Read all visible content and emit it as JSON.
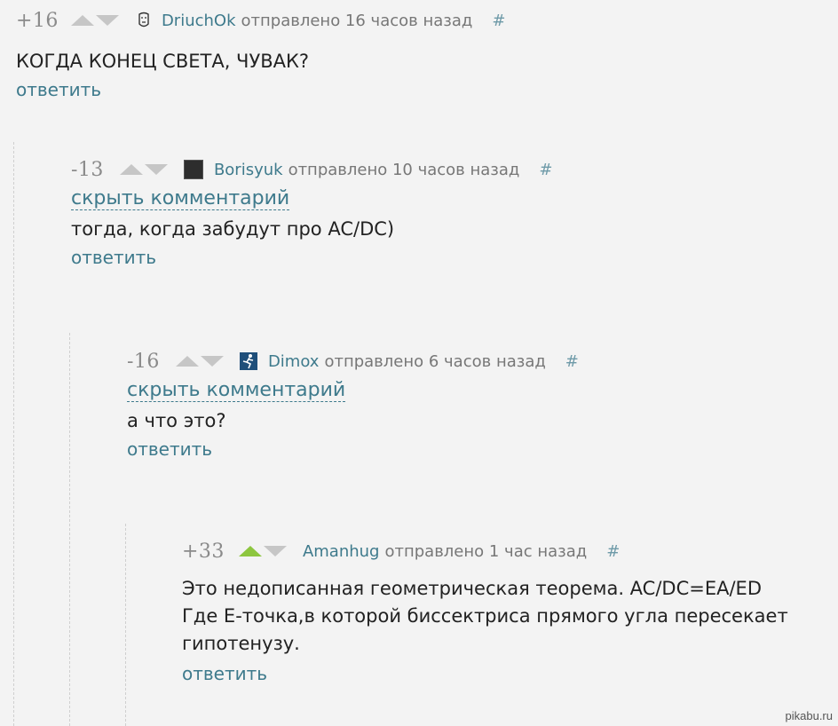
{
  "labels": {
    "reply": "ответить",
    "hide": "скрыть комментарий",
    "anchor": "#"
  },
  "colors": {
    "link": "#3e7a8c",
    "vote_active": "#8dc63f",
    "vote_idle": "#c6c6c6"
  },
  "comments": [
    {
      "score": "+16",
      "user": "DriuchOk",
      "posted": "отправлено 16 часов назад",
      "avatar_icon": "face-sketch-icon",
      "text": "КОГДА КОНЕЦ СВЕТА, ЧУВАК?",
      "upvoted": false
    },
    {
      "score": "-13",
      "user": "Borisyuk",
      "posted": "отправлено 10 часов назад",
      "avatar_icon": "dark-photo-avatar",
      "text": "тогда, когда забудут про AC/DC)",
      "upvoted": false
    },
    {
      "score": "-16",
      "user": "Dimox",
      "posted": "отправлено 6 часов назад",
      "avatar_icon": "running-figure-avatar",
      "text": "а что это?",
      "upvoted": false
    },
    {
      "score": "+33",
      "user": "Amanhug",
      "posted": "отправлено 1 час назад",
      "avatar_icon": "none",
      "text": "Это недописанная геометрическая теорема. AC/DC=EA/ED\nГде Е-точка,в которой биссектриса прямого угла пересекает\nгипотенузу.",
      "upvoted": true
    }
  ],
  "watermark": "pikabu.ru"
}
